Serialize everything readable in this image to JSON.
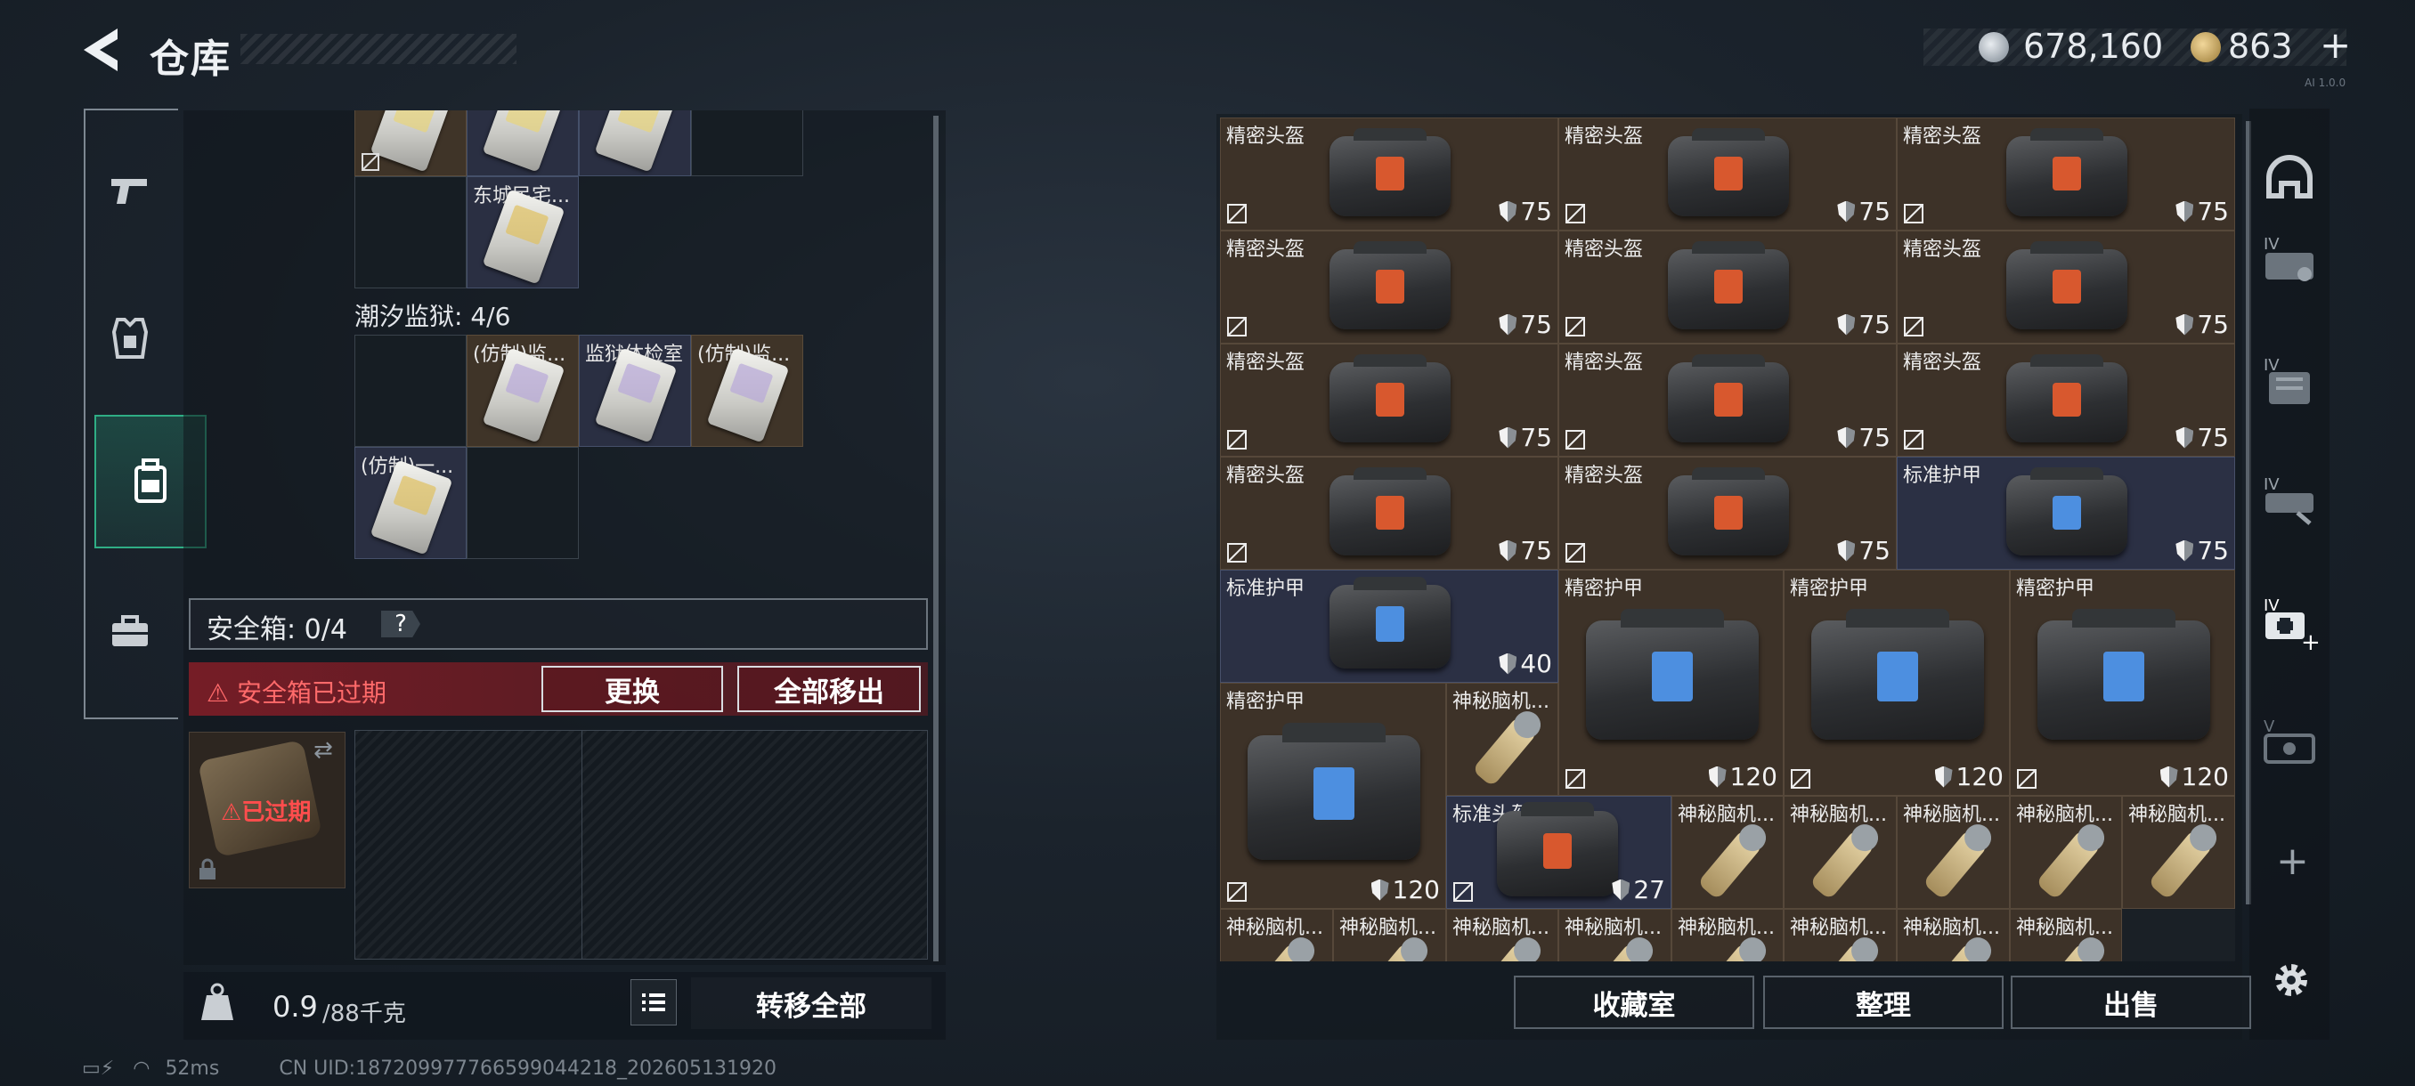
{
  "header": {
    "title": "仓库",
    "currency_silver": "678,160",
    "currency_gold": "863",
    "currency_plus": "+",
    "version": "AI 1.0.0"
  },
  "left_nav": {
    "items": [
      {
        "name": "weapon",
        "icon": "pistol-icon"
      },
      {
        "name": "equipment",
        "icon": "armor-icon"
      },
      {
        "name": "backpack",
        "icon": "backpack-icon",
        "active": true
      },
      {
        "name": "tools",
        "icon": "toolbox-icon"
      }
    ]
  },
  "storage": {
    "top_slots": [
      {
        "label": "",
        "item": true,
        "bg": "brown",
        "nodrop": true
      },
      {
        "label": "",
        "item": true,
        "bg": "navy"
      },
      {
        "label": "",
        "item": true,
        "bg": "navy"
      },
      {
        "label": "",
        "item": false,
        "bg": "dark"
      }
    ],
    "second_row": [
      {
        "label": "",
        "item": false,
        "bg": "dark"
      },
      {
        "label": "东城民宅...",
        "item": true,
        "bg": "navy"
      }
    ],
    "section_label": "潮汐监狱: 4/6",
    "prison_row1": [
      {
        "label": "",
        "item": false,
        "bg": "dark"
      },
      {
        "label": "(仿制)监...",
        "item": true,
        "bg": "brown"
      },
      {
        "label": "监狱体检室",
        "item": true,
        "bg": "navy"
      },
      {
        "label": "(仿制)监...",
        "item": true,
        "bg": "brown"
      }
    ],
    "prison_row2": [
      {
        "label": "(仿制)一...",
        "item": true,
        "bg": "navy"
      },
      {
        "label": "",
        "item": false,
        "bg": "dark"
      }
    ]
  },
  "safe_box": {
    "label": "安全箱: 0/4",
    "help": "?",
    "expired_warning": "安全箱已过期",
    "replace_label": "更换",
    "move_all_label": "全部移出",
    "item_expired_label": "已过期"
  },
  "weight": {
    "value": "0.9",
    "unit": "/88千克"
  },
  "transfer_all_label": "转移全部",
  "status": {
    "ping": "52ms",
    "uid": "CN UID:1872099777665990442​18_202605131920"
  },
  "inventory": {
    "rows": [
      [
        {
          "name": "精密头盔",
          "dur": "75"
        },
        {
          "name": "精密头盔",
          "dur": "75"
        },
        {
          "name": "精密头盔",
          "dur": "75"
        }
      ],
      [
        {
          "name": "精密头盔",
          "dur": "75"
        },
        {
          "name": "精密头盔",
          "dur": "75"
        },
        {
          "name": "精密头盔",
          "dur": "75"
        }
      ],
      [
        {
          "name": "精密头盔",
          "dur": "75"
        },
        {
          "name": "精密头盔",
          "dur": "75"
        },
        {
          "name": "精密头盔",
          "dur": "75"
        }
      ],
      [
        {
          "name": "精密头盔",
          "dur": "75"
        },
        {
          "name": "精密头盔",
          "dur": "75"
        },
        {
          "name": "标准护甲",
          "dur": "75"
        }
      ]
    ],
    "armor_row": {
      "standard": {
        "name": "标准护甲",
        "dur": "40"
      },
      "precision": [
        {
          "name": "精密护甲",
          "dur": "120"
        },
        {
          "name": "精密护甲",
          "dur": "120"
        },
        {
          "name": "精密护甲",
          "dur": "120"
        }
      ]
    },
    "big_armor": {
      "name": "精密护甲",
      "dur": "120"
    },
    "neural_top": {
      "name": "神秘脑机..."
    },
    "std_helmet": {
      "name": "标准头盔",
      "dur": "27"
    },
    "neural_row": [
      "神秘脑机...",
      "神秘脑机...",
      "神秘脑机...",
      "神秘脑机...",
      "神秘脑机..."
    ],
    "bottom_row": [
      "神秘脑机...",
      "神秘脑机...",
      "神秘脑机...",
      "神秘脑机...",
      "神秘脑机...",
      "神秘脑机...",
      "神秘脑机...",
      "神秘脑机..."
    ]
  },
  "actions": {
    "collection": "收藏室",
    "sort": "整理",
    "sell": "出售"
  },
  "right_rail": {
    "items": [
      "helmet-icon",
      "armor-tier-icon",
      "backpack-tier-icon",
      "rig-tier-icon",
      "medkit-tier-icon",
      "ticket-tier-icon"
    ],
    "plus": "+"
  }
}
